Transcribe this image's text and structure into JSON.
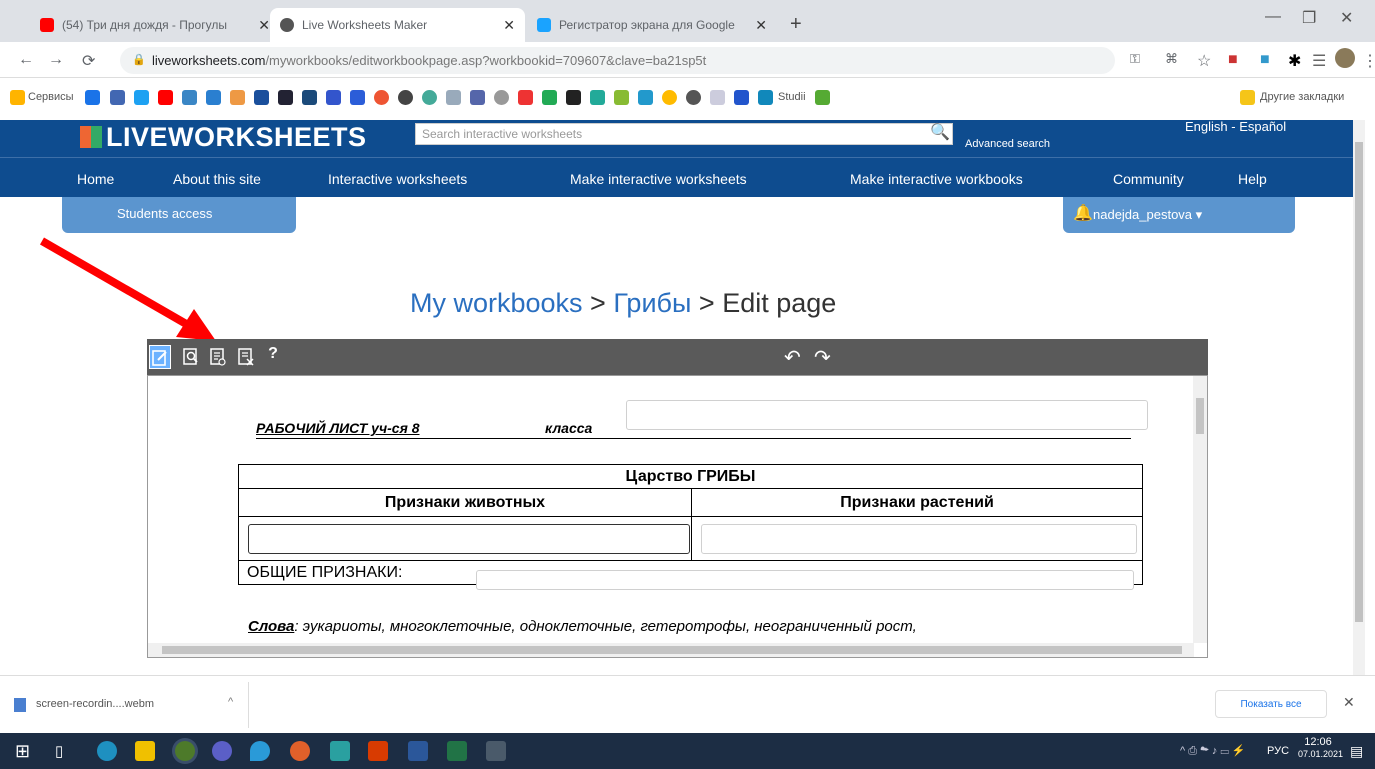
{
  "browser": {
    "tabs": [
      {
        "title": "(54) Три дня дождя - Прогулы",
        "fav_color": "#ff0000"
      },
      {
        "title": "Live Worksheets Maker",
        "fav_color": "#444444"
      },
      {
        "title": "Регистратор экрана для Google",
        "fav_color": "#1aa3ff"
      }
    ],
    "new_tab": "+",
    "url_host": "liveworksheets.com",
    "url_path": "/myworkbooks/editworkbookpage.asp?workbookid=709607&clave=ba21sp5t",
    "bookmarks_apps": "Сервисы",
    "bookmark_studi": "Studii",
    "other_bookmarks": "Другие закладки"
  },
  "site": {
    "logo": "LIVEWORKSHEETS",
    "search_placeholder": "Search interactive worksheets",
    "advanced_search": "Advanced search",
    "lang": "English - Español",
    "nav": [
      "Home",
      "About this site",
      "Interactive worksheets",
      "Make interactive worksheets",
      "Make interactive workbooks",
      "Community",
      "Help"
    ],
    "students_access": "Students access",
    "username": "nadejda_pestova ▾"
  },
  "breadcrumb": {
    "part1": "My workbooks",
    "sep1": " > ",
    "part2": "Грибы",
    "sep2": " > ",
    "part3": "Edit page"
  },
  "toolbar": {
    "help": "?",
    "undo": "↶",
    "redo": "↷"
  },
  "worksheet": {
    "title": "РАБОЧИЙ  ЛИСТ уч-ся 8",
    "class_label": "класса",
    "kingdom": "Царство ГРИБЫ",
    "animal_signs": "Признаки животных",
    "plant_signs": "Признаки растений",
    "common_signs": "ОБЩИЕ   ПРИЗНАКИ:",
    "words_label": "Слова",
    "words_text": ": эукариоты, многоклеточные, одноклеточные, гетеротрофы, неограниченный рост,"
  },
  "downloads": {
    "file": "screen-recordin....webm",
    "show_all": "Показать все",
    "close": "✕"
  },
  "tray": {
    "lang": "РУС",
    "time": "12:06",
    "date": "07.01.2021"
  }
}
